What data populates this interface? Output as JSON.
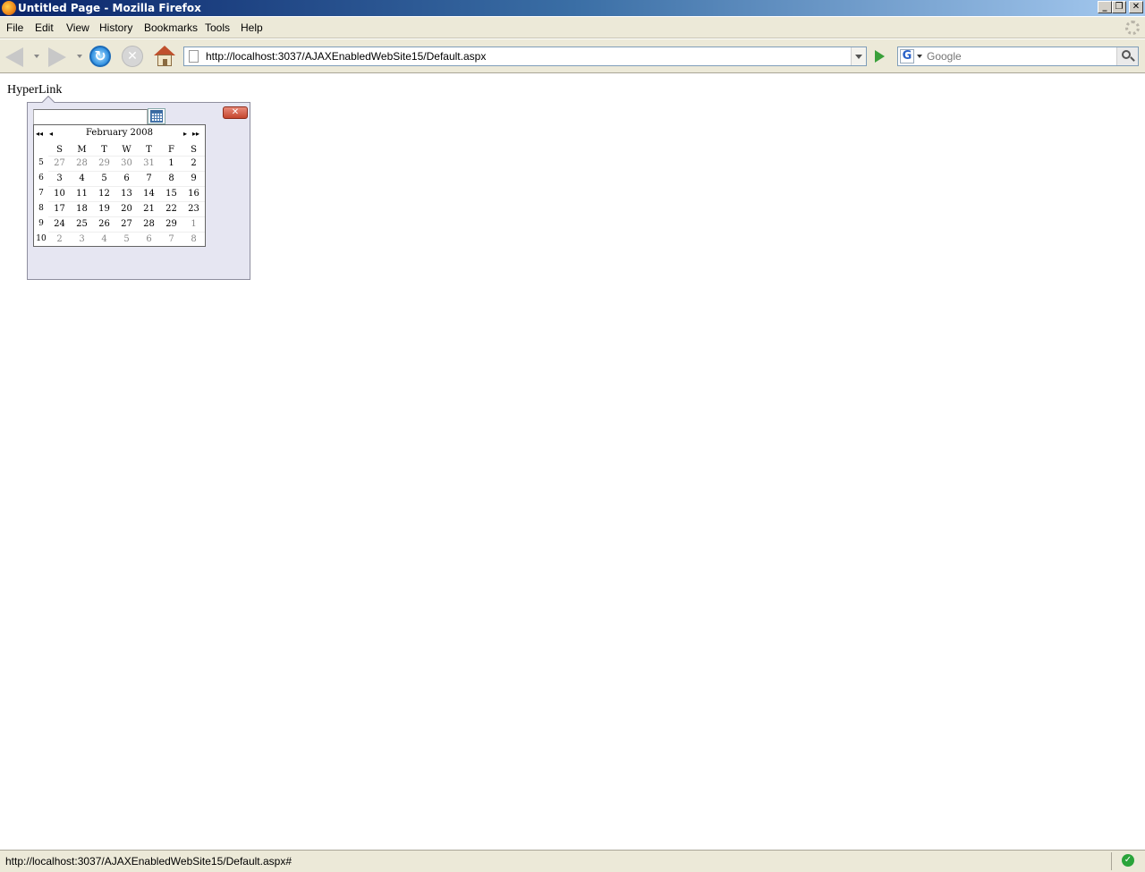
{
  "window": {
    "title": "Untitled Page - Mozilla Firefox",
    "controls": [
      "_",
      "❐",
      "✕"
    ]
  },
  "menubar": {
    "items": [
      "File",
      "Edit",
      "View",
      "History",
      "Bookmarks",
      "Tools",
      "Help"
    ]
  },
  "navbar": {
    "url": "http://localhost:3037/AJAXEnabledWebSite15/Default.aspx",
    "search_placeholder": "Google",
    "search_engine_letter": "G"
  },
  "page": {
    "hyperlink": "HyperLink"
  },
  "popup": {
    "date_value": "",
    "close_label": "✕"
  },
  "calendar": {
    "nav_prev_year": "◂◂",
    "nav_prev_month": "◂",
    "nav_next_month": "▸",
    "nav_next_year": "▸▸",
    "month_title": "February 2008",
    "days_of_week": [
      "S",
      "M",
      "T",
      "W",
      "T",
      "F",
      "S"
    ],
    "weeks": [
      {
        "wk": "5",
        "days": [
          "27",
          "28",
          "29",
          "30",
          "31",
          "1",
          "2"
        ],
        "other": [
          true,
          true,
          true,
          true,
          true,
          false,
          false
        ]
      },
      {
        "wk": "6",
        "days": [
          "3",
          "4",
          "5",
          "6",
          "7",
          "8",
          "9"
        ],
        "other": [
          false,
          false,
          false,
          false,
          false,
          false,
          false
        ]
      },
      {
        "wk": "7",
        "days": [
          "10",
          "11",
          "12",
          "13",
          "14",
          "15",
          "16"
        ],
        "other": [
          false,
          false,
          false,
          false,
          false,
          false,
          false
        ]
      },
      {
        "wk": "8",
        "days": [
          "17",
          "18",
          "19",
          "20",
          "21",
          "22",
          "23"
        ],
        "other": [
          false,
          false,
          false,
          false,
          false,
          false,
          false
        ]
      },
      {
        "wk": "9",
        "days": [
          "24",
          "25",
          "26",
          "27",
          "28",
          "29",
          "1"
        ],
        "other": [
          false,
          false,
          false,
          false,
          false,
          false,
          true
        ]
      },
      {
        "wk": "10",
        "days": [
          "2",
          "3",
          "4",
          "5",
          "6",
          "7",
          "8"
        ],
        "other": [
          true,
          true,
          true,
          true,
          true,
          true,
          true
        ]
      }
    ]
  },
  "statusbar": {
    "text": "http://localhost:3037/AJAXEnabledWebSite15/Default.aspx#"
  },
  "colors": {
    "titlebar_start": "#0a246a",
    "titlebar_end": "#a6caf0",
    "chrome_bg": "#ece9d8",
    "popup_bg": "#e6e6f2",
    "close_red": "#c4462e",
    "other_month_day": "#888888",
    "status_ok": "#2aa43a"
  }
}
